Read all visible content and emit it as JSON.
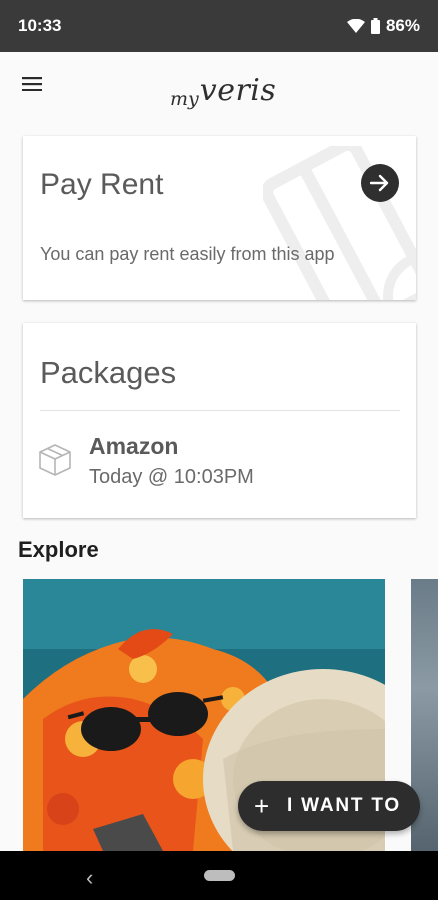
{
  "status_bar": {
    "time": "10:33",
    "battery": "86%",
    "icons": [
      "wifi-icon",
      "battery-icon"
    ]
  },
  "app_bar": {
    "menu_icon": "hamburger-menu-icon",
    "logo_prefix": "my",
    "logo_name": "veris"
  },
  "pay_rent": {
    "title": "Pay Rent",
    "description": "You can pay rent easily from this app",
    "action_icon": "arrow-right-icon"
  },
  "packages": {
    "title": "Packages",
    "items": [
      {
        "carrier": "Amazon",
        "time": "Today @ 10:03PM",
        "icon": "package-box-icon"
      }
    ]
  },
  "explore": {
    "title": "Explore"
  },
  "fab": {
    "icon": "plus-icon",
    "label": "I WANT TO"
  },
  "nav_bar": {
    "back_icon": "back-chevron-icon",
    "home_icon": "home-pill-icon"
  },
  "colors": {
    "status_bar": "#3a3a3a",
    "fab": "#2d2d2d",
    "card": "#ffffff",
    "background": "#fafafa"
  }
}
